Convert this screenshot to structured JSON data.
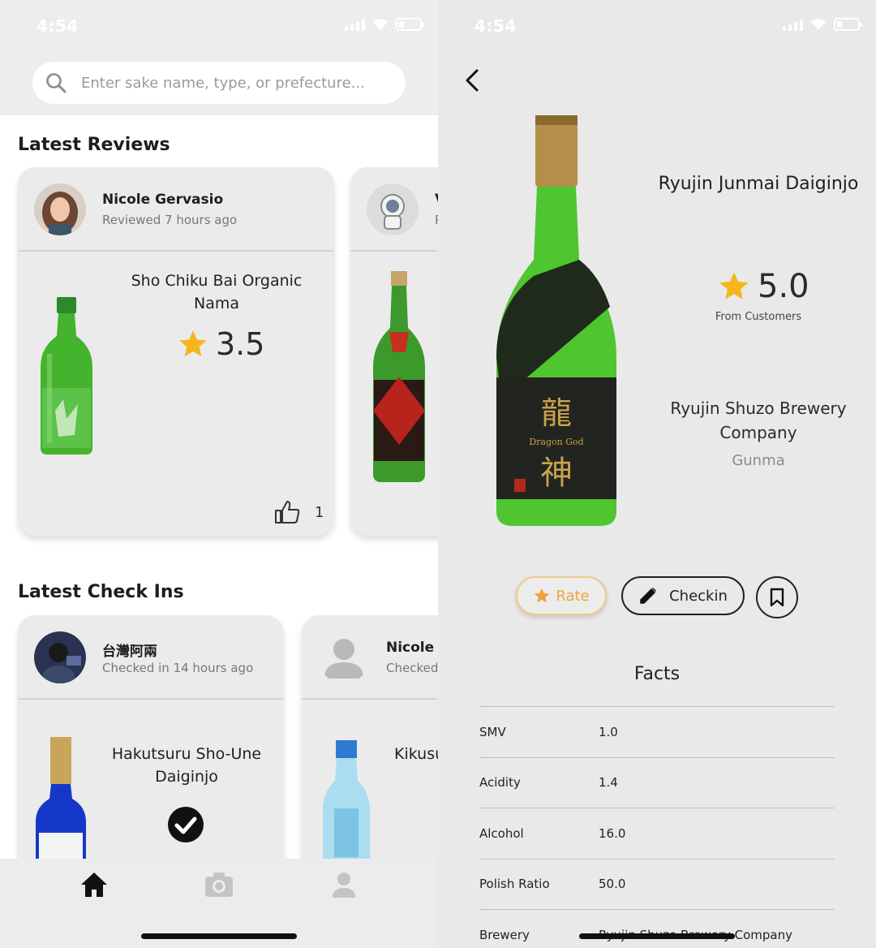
{
  "status": {
    "time": "4:54"
  },
  "search": {
    "placeholder": "Enter sake name, type, or prefecture..."
  },
  "reviews": {
    "title": "Latest Reviews",
    "cards": [
      {
        "user": "Nicole Gervasio",
        "meta": "Reviewed 7 hours ago",
        "sake": "Sho Chiku Bai Organic Nama",
        "rating": "3.5",
        "likes": "1"
      },
      {
        "user": "V",
        "meta": "R"
      }
    ]
  },
  "checkins": {
    "title": "Latest Check Ins",
    "cards": [
      {
        "user": "台灣阿兩",
        "meta": "Checked in 14 hours ago",
        "sake": "Hakutsuru Sho-Une Daiginjo"
      },
      {
        "user": "Nicole V",
        "meta": "Checked",
        "sake": "Kikusu"
      }
    ]
  },
  "nav": {
    "items": [
      "home-icon",
      "camera-icon",
      "profile-icon"
    ]
  },
  "detail": {
    "name": "Ryujin Junmai Daiginjo",
    "rating": "5.0",
    "rating_caption": "From Customers",
    "brewery": "Ryujin Shuzo Brewery Company",
    "prefecture": "Gunma",
    "rate_label": "Rate",
    "checkin_label": "Checkin",
    "facts_title": "Facts",
    "facts": [
      {
        "label": "SMV",
        "value": "1.0"
      },
      {
        "label": "Acidity",
        "value": "1.4"
      },
      {
        "label": "Alcohol",
        "value": "16.0"
      },
      {
        "label": "Polish Ratio",
        "value": "50.0"
      },
      {
        "label": "Brewery",
        "value": "Ryujin Shuzo Brewery Company"
      }
    ]
  },
  "colors": {
    "star": "#f6b51b",
    "bottle_green": "#3fae2a",
    "rate_accent": "#f0a23c"
  }
}
